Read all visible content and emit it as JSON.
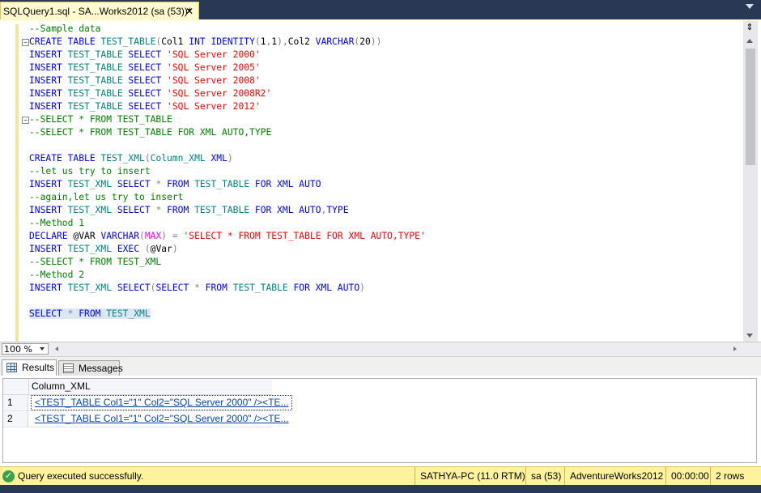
{
  "tab": {
    "title": "SQLQuery1.sql - SA...Works2012 (sa (53))*",
    "close": "✕"
  },
  "editor": {
    "lines": [
      [
        [
          "cm",
          "--Sample data"
        ]
      ],
      [
        [
          "kw",
          "CREATE TABLE "
        ],
        [
          "tb",
          "TEST_TABLE"
        ],
        [
          "gr",
          "("
        ],
        [
          "",
          "Col1 "
        ],
        [
          "kw",
          "INT IDENTITY"
        ],
        [
          "gr",
          "("
        ],
        [
          "",
          "1"
        ],
        [
          "gr",
          ","
        ],
        [
          "",
          "1"
        ],
        [
          "gr",
          "),"
        ],
        [
          "",
          "Col2 "
        ],
        [
          "kw",
          "VARCHAR"
        ],
        [
          "gr",
          "("
        ],
        [
          "",
          "20"
        ],
        [
          "gr",
          "))"
        ]
      ],
      [
        [
          "kw",
          "INSERT "
        ],
        [
          "tb",
          "TEST_TABLE"
        ],
        [
          "kw",
          " SELECT "
        ],
        [
          "str",
          "'SQL Server 2000'"
        ]
      ],
      [
        [
          "kw",
          "INSERT "
        ],
        [
          "tb",
          "TEST_TABLE"
        ],
        [
          "kw",
          " SELECT "
        ],
        [
          "str",
          "'SQL Server 2005'"
        ]
      ],
      [
        [
          "kw",
          "INSERT "
        ],
        [
          "tb",
          "TEST_TABLE"
        ],
        [
          "kw",
          " SELECT "
        ],
        [
          "str",
          "'SQL Server 2008'"
        ]
      ],
      [
        [
          "kw",
          "INSERT "
        ],
        [
          "tb",
          "TEST_TABLE"
        ],
        [
          "kw",
          " SELECT "
        ],
        [
          "str",
          "'SQL Server 2008R2'"
        ]
      ],
      [
        [
          "kw",
          "INSERT "
        ],
        [
          "tb",
          "TEST_TABLE"
        ],
        [
          "kw",
          " SELECT "
        ],
        [
          "str",
          "'SQL Server 2012'"
        ]
      ],
      [
        [
          "cm",
          "--SELECT * FROM TEST_TABLE"
        ]
      ],
      [
        [
          "cm",
          "--SELECT * FROM TEST_TABLE FOR XML AUTO,TYPE"
        ]
      ],
      [
        [
          "",
          ""
        ]
      ],
      [
        [
          "kw",
          "CREATE TABLE "
        ],
        [
          "tb",
          "TEST_XML"
        ],
        [
          "gr",
          "("
        ],
        [
          "tb",
          "Column_XML"
        ],
        [
          "kw",
          " XML"
        ],
        [
          "gr",
          ")"
        ]
      ],
      [
        [
          "cm",
          "--let us try to insert"
        ]
      ],
      [
        [
          "kw",
          "INSERT "
        ],
        [
          "tb",
          "TEST_XML"
        ],
        [
          "kw",
          " SELECT "
        ],
        [
          "gr",
          "* "
        ],
        [
          "kw",
          "FROM "
        ],
        [
          "tb",
          "TEST_TABLE"
        ],
        [
          "kw",
          " FOR XML AUTO"
        ]
      ],
      [
        [
          "cm",
          "--again,let us try to insert"
        ]
      ],
      [
        [
          "kw",
          "INSERT "
        ],
        [
          "tb",
          "TEST_XML"
        ],
        [
          "kw",
          " SELECT "
        ],
        [
          "gr",
          "* "
        ],
        [
          "kw",
          "FROM "
        ],
        [
          "tb",
          "TEST_TABLE"
        ],
        [
          "kw",
          " FOR XML AUTO"
        ],
        [
          "gr",
          ","
        ],
        [
          "kw",
          "TYPE"
        ]
      ],
      [
        [
          "cm",
          "--Method 1"
        ]
      ],
      [
        [
          "kw",
          "DECLARE "
        ],
        [
          "",
          "@VAR "
        ],
        [
          "kw",
          "VARCHAR"
        ],
        [
          "gr",
          "("
        ],
        [
          "pk",
          "MAX"
        ],
        [
          "gr",
          ") = "
        ],
        [
          "str",
          "'SELECT * FROM TEST_TABLE FOR XML AUTO,TYPE'"
        ]
      ],
      [
        [
          "kw",
          "INSERT "
        ],
        [
          "tb",
          "TEST_XML"
        ],
        [
          "kw",
          " EXEC "
        ],
        [
          "gr",
          "("
        ],
        [
          "",
          "@Var"
        ],
        [
          "gr",
          ")"
        ]
      ],
      [
        [
          "cm",
          "--SELECT * FROM TEST_XML"
        ]
      ],
      [
        [
          "cm",
          "--Method 2"
        ]
      ],
      [
        [
          "kw",
          "INSERT "
        ],
        [
          "tb",
          "TEST_XML"
        ],
        [
          "kw",
          " SELECT"
        ],
        [
          "gr",
          "("
        ],
        [
          "kw",
          "SELECT "
        ],
        [
          "gr",
          "* "
        ],
        [
          "kw",
          "FROM "
        ],
        [
          "tb",
          "TEST_TABLE"
        ],
        [
          "kw",
          " FOR XML AUTO"
        ],
        [
          "gr",
          ")"
        ]
      ],
      [
        [
          "",
          ""
        ]
      ],
      [
        [
          "kw",
          "SELECT "
        ],
        [
          "gr",
          "* "
        ],
        [
          "kw",
          "FROM "
        ],
        [
          "tb",
          "TEST_XML"
        ]
      ]
    ],
    "selected_line": 22,
    "fold_lines": [
      1,
      7
    ],
    "fold_symbol": "−"
  },
  "zoom": {
    "value": "100 %"
  },
  "results_tabs": [
    {
      "label": "Results",
      "icon": "grid-icon",
      "active": true
    },
    {
      "label": "Messages",
      "icon": "messages-icon",
      "active": false
    }
  ],
  "grid": {
    "column": "Column_XML",
    "rows": [
      {
        "num": "1",
        "value": "<TEST_TABLE Col1=\"1\" Col2=\"SQL Server 2000\" /><TE..."
      },
      {
        "num": "2",
        "value": "<TEST_TABLE Col1=\"1\" Col2=\"SQL Server 2000\" /><TE..."
      }
    ]
  },
  "status": {
    "icon": "check-icon",
    "icon_glyph": "✓",
    "message": "Query executed successfully.",
    "server": "SATHYA-PC (11.0 RTM)",
    "user": "sa (53)",
    "database": "AdventureWorks2012",
    "elapsed": "00:00:00",
    "rows": "2 rows"
  },
  "colors": {
    "frame": "#293955",
    "tab_active": "#fff9cf",
    "status_bar": "#fff29d",
    "keyword": "#0000ff",
    "string": "#ff0000",
    "comment": "#008000",
    "table": "#008080"
  }
}
